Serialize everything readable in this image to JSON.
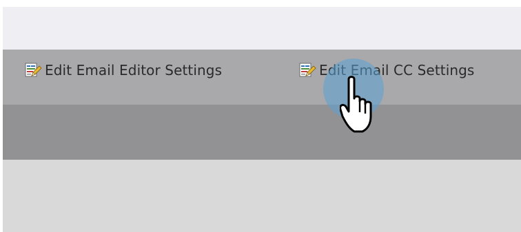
{
  "toolbar": {
    "edit_editor_label": "Edit Email Editor Settings",
    "edit_cc_label": "Edit Email CC Settings"
  },
  "icons": {
    "button_icon": "edit-document-icon",
    "cursor": "hand-pointer-icon"
  },
  "colors": {
    "top_band": "#eeeef3",
    "toolbar_band": "#a9a9ac",
    "dark_band": "#929295",
    "bottom_band": "#d9d9d9",
    "click_highlight": "#5aa0d2"
  }
}
